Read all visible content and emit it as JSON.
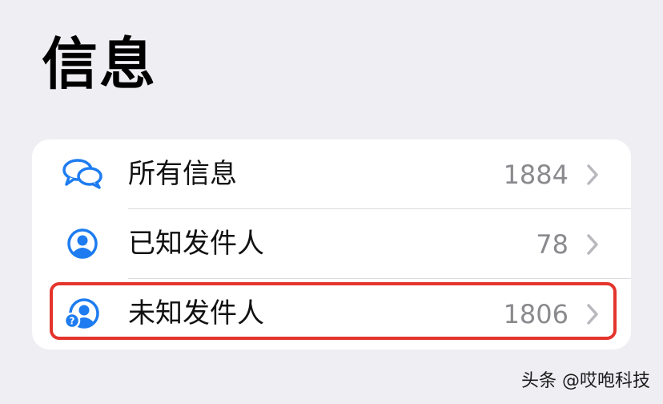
{
  "header": {
    "title": "信息"
  },
  "filters": [
    {
      "label": "所有信息",
      "count": "1884",
      "icon": "speech-bubbles-icon"
    },
    {
      "label": "已知发件人",
      "count": "78",
      "icon": "person-circle-icon"
    },
    {
      "label": "未知发件人",
      "count": "1806",
      "icon": "unknown-sender-icon"
    }
  ],
  "colors": {
    "accent": "#1e7cf0",
    "highlight": "#e4352d",
    "background": "#efeef3",
    "count_gray": "#8a8a8e"
  },
  "watermark": {
    "text": "头条 @哎咆科技"
  }
}
